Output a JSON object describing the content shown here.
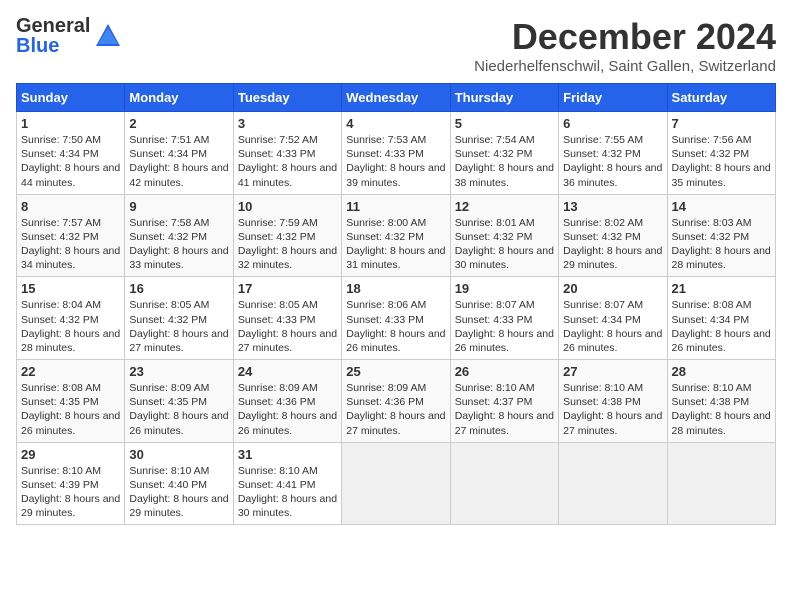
{
  "logo": {
    "general": "General",
    "blue": "Blue"
  },
  "header": {
    "month": "December 2024",
    "location": "Niederhelfenschwil, Saint Gallen, Switzerland"
  },
  "weekdays": [
    "Sunday",
    "Monday",
    "Tuesday",
    "Wednesday",
    "Thursday",
    "Friday",
    "Saturday"
  ],
  "weeks": [
    [
      {
        "day": "1",
        "sunrise": "7:50 AM",
        "sunset": "4:34 PM",
        "daylight": "8 hours and 44 minutes."
      },
      {
        "day": "2",
        "sunrise": "7:51 AM",
        "sunset": "4:34 PM",
        "daylight": "8 hours and 42 minutes."
      },
      {
        "day": "3",
        "sunrise": "7:52 AM",
        "sunset": "4:33 PM",
        "daylight": "8 hours and 41 minutes."
      },
      {
        "day": "4",
        "sunrise": "7:53 AM",
        "sunset": "4:33 PM",
        "daylight": "8 hours and 39 minutes."
      },
      {
        "day": "5",
        "sunrise": "7:54 AM",
        "sunset": "4:32 PM",
        "daylight": "8 hours and 38 minutes."
      },
      {
        "day": "6",
        "sunrise": "7:55 AM",
        "sunset": "4:32 PM",
        "daylight": "8 hours and 36 minutes."
      },
      {
        "day": "7",
        "sunrise": "7:56 AM",
        "sunset": "4:32 PM",
        "daylight": "8 hours and 35 minutes."
      }
    ],
    [
      {
        "day": "8",
        "sunrise": "7:57 AM",
        "sunset": "4:32 PM",
        "daylight": "8 hours and 34 minutes."
      },
      {
        "day": "9",
        "sunrise": "7:58 AM",
        "sunset": "4:32 PM",
        "daylight": "8 hours and 33 minutes."
      },
      {
        "day": "10",
        "sunrise": "7:59 AM",
        "sunset": "4:32 PM",
        "daylight": "8 hours and 32 minutes."
      },
      {
        "day": "11",
        "sunrise": "8:00 AM",
        "sunset": "4:32 PM",
        "daylight": "8 hours and 31 minutes."
      },
      {
        "day": "12",
        "sunrise": "8:01 AM",
        "sunset": "4:32 PM",
        "daylight": "8 hours and 30 minutes."
      },
      {
        "day": "13",
        "sunrise": "8:02 AM",
        "sunset": "4:32 PM",
        "daylight": "8 hours and 29 minutes."
      },
      {
        "day": "14",
        "sunrise": "8:03 AM",
        "sunset": "4:32 PM",
        "daylight": "8 hours and 28 minutes."
      }
    ],
    [
      {
        "day": "15",
        "sunrise": "8:04 AM",
        "sunset": "4:32 PM",
        "daylight": "8 hours and 28 minutes."
      },
      {
        "day": "16",
        "sunrise": "8:05 AM",
        "sunset": "4:32 PM",
        "daylight": "8 hours and 27 minutes."
      },
      {
        "day": "17",
        "sunrise": "8:05 AM",
        "sunset": "4:33 PM",
        "daylight": "8 hours and 27 minutes."
      },
      {
        "day": "18",
        "sunrise": "8:06 AM",
        "sunset": "4:33 PM",
        "daylight": "8 hours and 26 minutes."
      },
      {
        "day": "19",
        "sunrise": "8:07 AM",
        "sunset": "4:33 PM",
        "daylight": "8 hours and 26 minutes."
      },
      {
        "day": "20",
        "sunrise": "8:07 AM",
        "sunset": "4:34 PM",
        "daylight": "8 hours and 26 minutes."
      },
      {
        "day": "21",
        "sunrise": "8:08 AM",
        "sunset": "4:34 PM",
        "daylight": "8 hours and 26 minutes."
      }
    ],
    [
      {
        "day": "22",
        "sunrise": "8:08 AM",
        "sunset": "4:35 PM",
        "daylight": "8 hours and 26 minutes."
      },
      {
        "day": "23",
        "sunrise": "8:09 AM",
        "sunset": "4:35 PM",
        "daylight": "8 hours and 26 minutes."
      },
      {
        "day": "24",
        "sunrise": "8:09 AM",
        "sunset": "4:36 PM",
        "daylight": "8 hours and 26 minutes."
      },
      {
        "day": "25",
        "sunrise": "8:09 AM",
        "sunset": "4:36 PM",
        "daylight": "8 hours and 27 minutes."
      },
      {
        "day": "26",
        "sunrise": "8:10 AM",
        "sunset": "4:37 PM",
        "daylight": "8 hours and 27 minutes."
      },
      {
        "day": "27",
        "sunrise": "8:10 AM",
        "sunset": "4:38 PM",
        "daylight": "8 hours and 27 minutes."
      },
      {
        "day": "28",
        "sunrise": "8:10 AM",
        "sunset": "4:38 PM",
        "daylight": "8 hours and 28 minutes."
      }
    ],
    [
      {
        "day": "29",
        "sunrise": "8:10 AM",
        "sunset": "4:39 PM",
        "daylight": "8 hours and 29 minutes."
      },
      {
        "day": "30",
        "sunrise": "8:10 AM",
        "sunset": "4:40 PM",
        "daylight": "8 hours and 29 minutes."
      },
      {
        "day": "31",
        "sunrise": "8:10 AM",
        "sunset": "4:41 PM",
        "daylight": "8 hours and 30 minutes."
      },
      null,
      null,
      null,
      null
    ]
  ]
}
